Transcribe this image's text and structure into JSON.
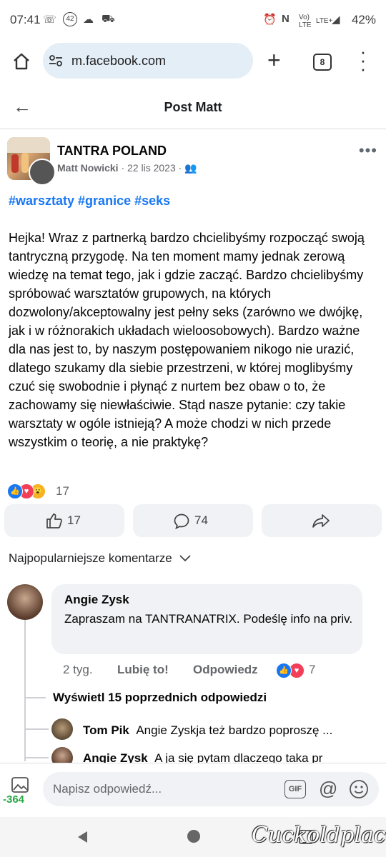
{
  "status_bar": {
    "time": "07:41",
    "badge": "42",
    "battery": "42%"
  },
  "browser": {
    "url": "m.facebook.com",
    "tab_count": "8"
  },
  "header": {
    "title": "Post Matt"
  },
  "post": {
    "group": "TANTRA POLAND",
    "author": "Matt Nowicki",
    "date": "22 lis 2023",
    "hashtags": "#warsztaty #granice #seks",
    "text": "Hejka! Wraz z partnerką bardzo chcielibyśmy rozpocząć swoją tantryczną przygodę. Na ten moment mamy jednak zerową wiedzę na temat tego, jak i gdzie zacząć. Bardzo chcielibyśmy spróbować warsztatów grupowych, na których dozwolony/akceptowalny jest pełny seks (zarówno we dwójkę, jak i w różnorakich układach wieloosobowych). Bardzo ważne dla nas jest to, by naszym postępowaniem nikogo nie urazić, dlatego szukamy dla siebie przestrzeni, w której moglibyśmy czuć się swobodnie i płynąć z nurtem bez obaw o to, że zachowamy się niewłaściwie. Stąd nasze pytanie: czy takie warsztaty w ogóle istnieją? A może chodzi w nich przede wszystkim o teorię, a nie praktykę?",
    "reaction_count": "17",
    "like_count": "17",
    "comment_count": "74"
  },
  "comments_section": {
    "sort_label": "Najpopularniejsze komentarze",
    "comment": {
      "name": "Angie Zysk",
      "text": "Zapraszam na TANTRANATRIX. Podeślę info na priv.",
      "age": "2 tyg.",
      "like_label": "Lubię to!",
      "reply_label": "Odpowiedz",
      "reaction_count": "7"
    },
    "show_previous": "Wyświetl 15 poprzednich odpowiedzi",
    "replies": [
      {
        "name": "Tom Pik",
        "text": "Angie Zyskja też bardzo poproszę ..."
      },
      {
        "name": "Angie Zysk",
        "text": "A ja się pytam dlaczego taka pr"
      }
    ]
  },
  "input": {
    "placeholder": "Napisz odpowiedź...",
    "gif_label": "GIF",
    "sticker_badge": "-364"
  },
  "watermark": "Cuckoldplace",
  "colors": {
    "link": "#1877f2",
    "like": "#1877f2",
    "love": "#f33e58",
    "wow": "#f7b125"
  }
}
